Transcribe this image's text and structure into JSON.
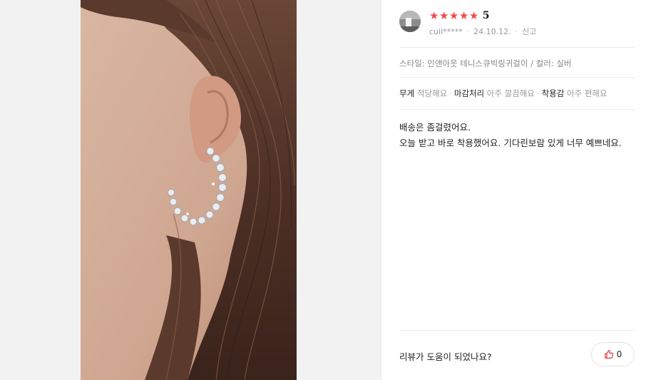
{
  "review": {
    "rating_stars": 5,
    "rating_value": "5",
    "user_name": "cuil*****",
    "date": "24.10.12.",
    "report_label": "신고",
    "option_text": "스타일: 인앤아웃 테니스큐빅링귀걸이 / 컬러: 실버",
    "attributes": [
      {
        "key": "무게",
        "value": "적당해요"
      },
      {
        "key": "마감처리",
        "value": "아주 깔끔해요"
      },
      {
        "key": "착용감",
        "value": "아주 편해요"
      }
    ],
    "body_lines": [
      "배송은 좀걸렸어요.",
      "오늘 받고 바로 착용했어요. 기다린보람 있게 너무 예쁘네요."
    ]
  },
  "feedback": {
    "question": "리뷰가 도움이 되었나요?",
    "like_count": "0"
  },
  "colors": {
    "star": "#f04a4a",
    "like_icon": "#e03c3c",
    "gutter": "#f2f2f2"
  },
  "icons": [
    "star-icon",
    "thumbs-up-icon",
    "avatar"
  ]
}
